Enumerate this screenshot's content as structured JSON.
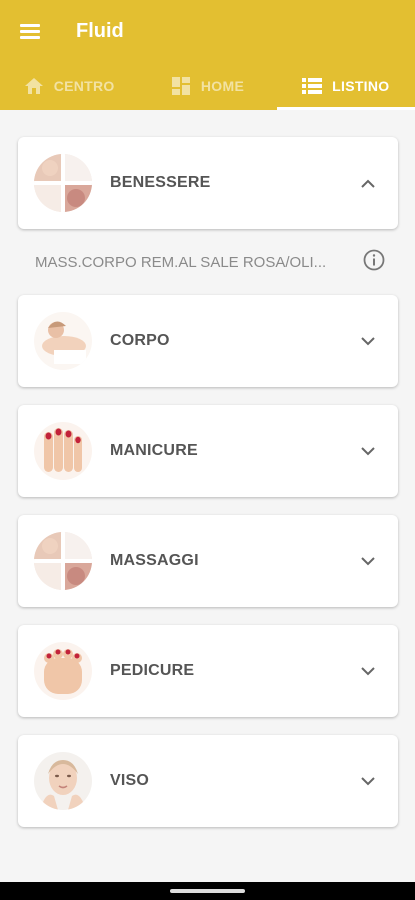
{
  "app": {
    "title": "Fluid"
  },
  "tabs": [
    {
      "label": "CENTRO",
      "icon": "home-icon",
      "active": false
    },
    {
      "label": "HOME",
      "icon": "dashboard-icon",
      "active": false
    },
    {
      "label": "LISTINO",
      "icon": "list-icon",
      "active": true
    }
  ],
  "categories": [
    {
      "label": "BENESSERE",
      "icon": "collage-icon",
      "expanded": true
    },
    {
      "label": "CORPO",
      "icon": "body-icon",
      "expanded": false
    },
    {
      "label": "MANICURE",
      "icon": "hand-icon",
      "expanded": false
    },
    {
      "label": "MASSAGGI",
      "icon": "collage-icon",
      "expanded": false
    },
    {
      "label": "PEDICURE",
      "icon": "foot-icon",
      "expanded": false
    },
    {
      "label": "VISO",
      "icon": "face-icon",
      "expanded": false
    }
  ],
  "expanded_item": {
    "text": "MASS.CORPO REM.AL SALE ROSA/OLI...",
    "icon": "info-icon"
  },
  "colors": {
    "accent": "#e3bf31",
    "background": "#f5f5f5",
    "label": "#555555"
  }
}
